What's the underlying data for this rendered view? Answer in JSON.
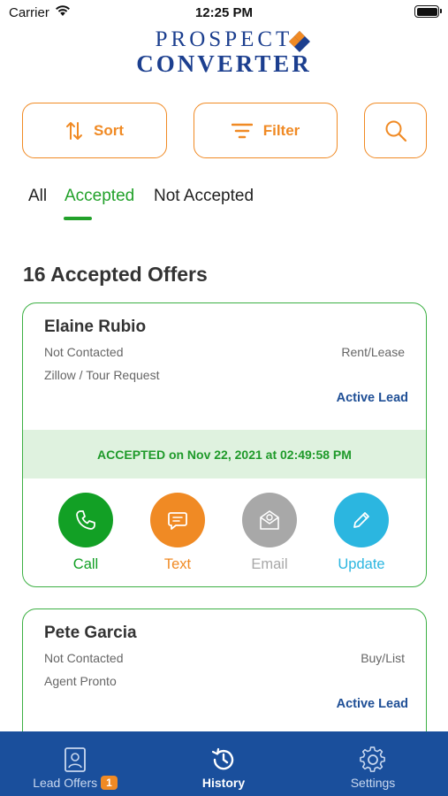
{
  "status_bar": {
    "carrier": "Carrier",
    "time": "12:25 PM"
  },
  "logo": {
    "line1": "PROSPECT",
    "line2": "CONVERTER"
  },
  "toolbar": {
    "sort_label": "Sort",
    "filter_label": "Filter"
  },
  "tabs": [
    {
      "label": "All",
      "selected": false
    },
    {
      "label": "Accepted",
      "selected": true
    },
    {
      "label": "Not Accepted",
      "selected": false
    }
  ],
  "section_title": "16 Accepted Offers",
  "offers": [
    {
      "name": "Elaine Rubio",
      "status": "Not Contacted",
      "type": "Rent/Lease",
      "source": "Zillow / Tour Request",
      "lead_status": "Active Lead",
      "accepted_text": "ACCEPTED on Nov 22, 2021 at 02:49:58 PM",
      "actions": [
        {
          "label": "Call",
          "icon": "phone-icon",
          "color": "#12a025",
          "enabled": true
        },
        {
          "label": "Text",
          "icon": "message-icon",
          "color": "#f08a24",
          "enabled": true
        },
        {
          "label": "Email",
          "icon": "email-icon",
          "color": "#a8a8a8",
          "enabled": false
        },
        {
          "label": "Update",
          "icon": "pencil-icon",
          "color": "#2bb6e0",
          "enabled": true
        }
      ]
    },
    {
      "name": "Pete Garcia",
      "status": "Not Contacted",
      "type": "Buy/List",
      "source": "Agent Pronto",
      "lead_status": "Active Lead"
    }
  ],
  "bottom_nav": {
    "items": [
      {
        "label": "Lead Offers",
        "icon": "contact-card-icon",
        "badge": "1",
        "selected": false
      },
      {
        "label": "History",
        "icon": "history-icon",
        "selected": true
      },
      {
        "label": "Settings",
        "icon": "gear-icon",
        "selected": false
      }
    ]
  },
  "colors": {
    "brand_blue": "#1a4f9c",
    "accent_orange": "#f08a24",
    "accepted_green": "#22a12a",
    "update_cyan": "#2bb6e0",
    "disabled_gray": "#a8a8a8"
  }
}
